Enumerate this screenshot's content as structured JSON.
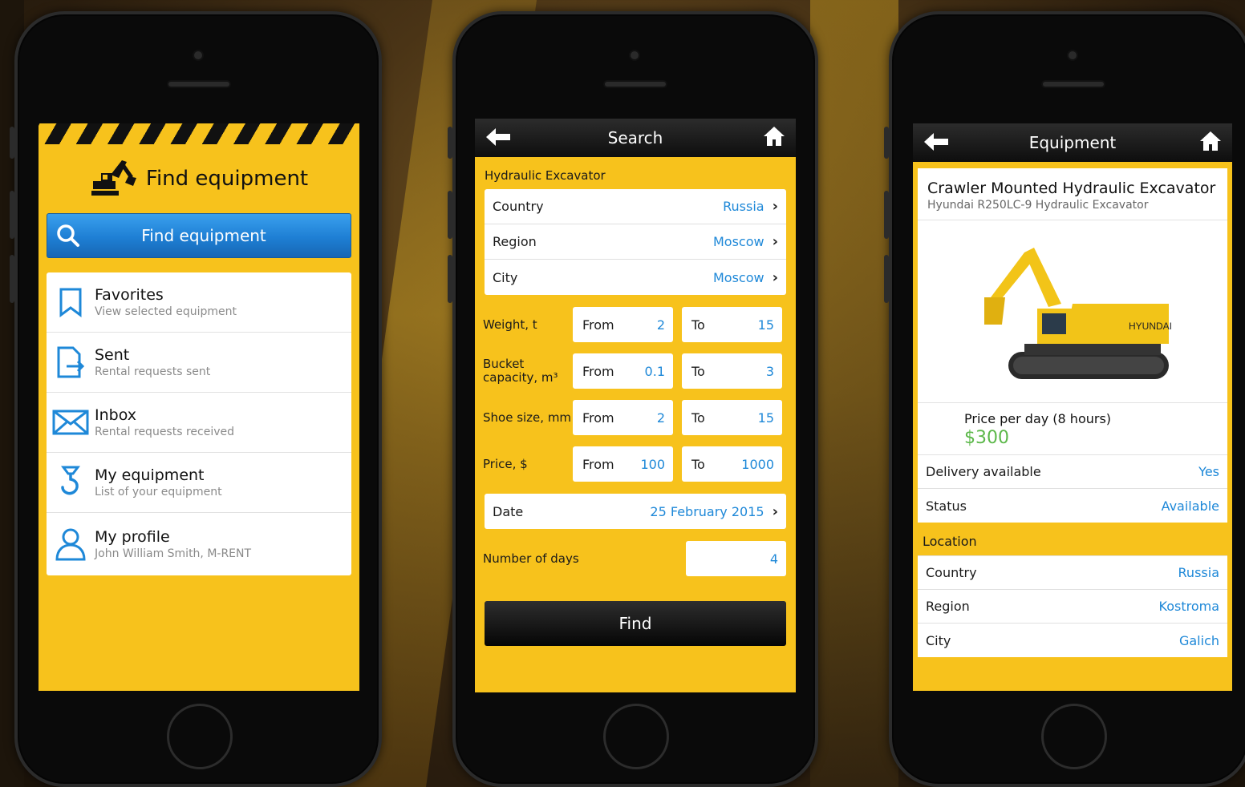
{
  "phone1": {
    "title": "Find equipment",
    "find_button": "Find equipment",
    "menu": [
      {
        "title": "Favorites",
        "subtitle": "View selected equipment",
        "icon": "bookmark-icon"
      },
      {
        "title": "Sent",
        "subtitle": "Rental requests sent",
        "icon": "document-send-icon"
      },
      {
        "title": "Inbox",
        "subtitle": "Rental requests received",
        "icon": "envelope-icon"
      },
      {
        "title": "My equipment",
        "subtitle": "List of your equipment",
        "icon": "hook-icon"
      },
      {
        "title": "My profile",
        "subtitle": "John William Smith, M-RENT",
        "icon": "user-icon"
      }
    ]
  },
  "phone2": {
    "nav_title": "Search",
    "section": "Hydraulic Excavator",
    "location": [
      {
        "label": "Country",
        "value": "Russia"
      },
      {
        "label": "Region",
        "value": "Moscow"
      },
      {
        "label": "City",
        "value": "Moscow"
      }
    ],
    "ranges": [
      {
        "label": "Weight, t",
        "from_label": "From",
        "from": "2",
        "to_label": "To",
        "to": "15"
      },
      {
        "label": "Bucket capacity, m³",
        "from_label": "From",
        "from": "0.1",
        "to_label": "To",
        "to": "3"
      },
      {
        "label": "Shoe size, mm",
        "from_label": "From",
        "from": "2",
        "to_label": "To",
        "to": "15"
      },
      {
        "label": "Price, $",
        "from_label": "From",
        "from": "100",
        "to_label": "To",
        "to": "1000"
      }
    ],
    "date": {
      "label": "Date",
      "value": "25 February 2015"
    },
    "days": {
      "label": "Number of days",
      "value": "4"
    },
    "find_button": "Find"
  },
  "phone3": {
    "nav_title": "Equipment",
    "title": "Crawler Mounted Hydraulic Excavator",
    "subtitle": "Hyundai R250LC-9 Hydraulic Excavator",
    "price_label": "Price per day (8 hours)",
    "price_value": "$300",
    "details": [
      {
        "label": "Delivery available",
        "value": "Yes"
      },
      {
        "label": "Status",
        "value": "Available"
      }
    ],
    "location_label": "Location",
    "location": [
      {
        "label": "Country",
        "value": "Russia"
      },
      {
        "label": "Region",
        "value": "Kostroma"
      },
      {
        "label": "City",
        "value": "Galich"
      }
    ]
  },
  "colors": {
    "yellow": "#f7c21c",
    "blue": "#1e88d8",
    "green": "#5cb84a"
  }
}
